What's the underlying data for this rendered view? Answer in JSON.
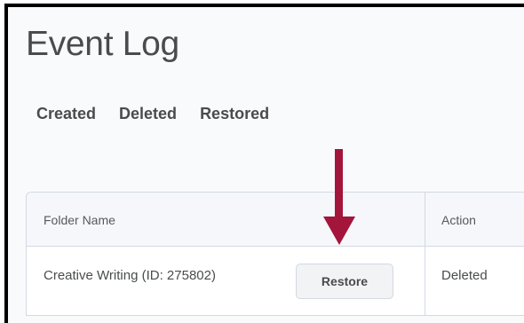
{
  "page": {
    "title": "Event Log"
  },
  "tabs": [
    {
      "label": "Created"
    },
    {
      "label": "Deleted"
    },
    {
      "label": "Restored"
    }
  ],
  "table": {
    "columns": {
      "folder_name": "Folder Name",
      "action": "Action"
    },
    "rows": [
      {
        "folder_name": "Creative Writing (ID: 275802)",
        "button_label": "Restore",
        "action": "Deleted"
      }
    ]
  },
  "annotation": {
    "icon": "down-arrow-icon",
    "color": "#a3153a"
  }
}
